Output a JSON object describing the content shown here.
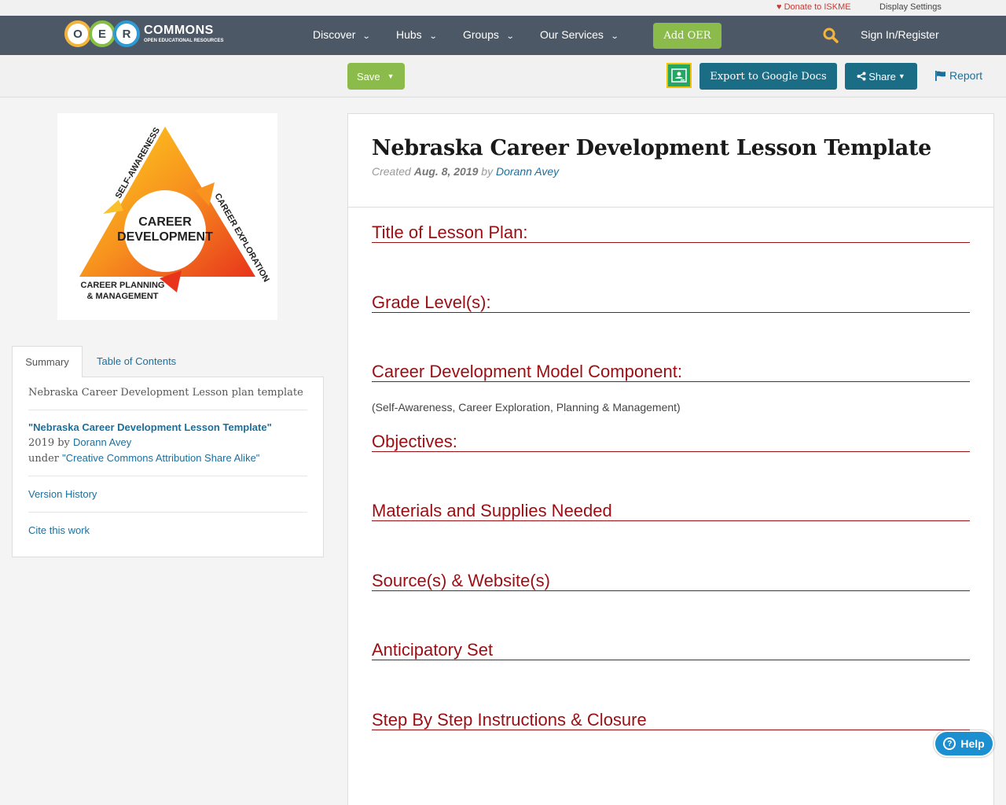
{
  "topbar": {
    "donate": "Donate to ISKME",
    "display_settings": "Display Settings"
  },
  "logo": {
    "letters": [
      "O",
      "E",
      "R"
    ],
    "name": "COMMONS",
    "tagline": "OPEN EDUCATIONAL RESOURCES"
  },
  "nav": {
    "items": [
      {
        "label": "Discover"
      },
      {
        "label": "Hubs"
      },
      {
        "label": "Groups"
      },
      {
        "label": "Our Services"
      }
    ],
    "add_oer": "Add OER",
    "sign_in": "Sign In/Register"
  },
  "toolbar": {
    "save": "Save",
    "export": "Export to Google Docs",
    "share": "Share",
    "report": "Report"
  },
  "cover": {
    "center": [
      "CAREER",
      "DEVELOPMENT"
    ],
    "side_left": "SELF-AWARENESS",
    "side_right": "CAREER EXPLORATION",
    "bottom": [
      "CAREER PLANNING",
      "& MANAGEMENT"
    ]
  },
  "sidebar": {
    "tabs": [
      "Summary",
      "Table of Contents"
    ],
    "description": "Nebraska Career Development Lesson plan template",
    "attribution": {
      "title": "\"Nebraska Career Development Lesson Template\"",
      "year_by": "2019 by",
      "author": "Dorann Avey",
      "under": "under",
      "license": "\"Creative Commons Attribution Share Alike\""
    },
    "version_history": "Version History",
    "cite": "Cite this work"
  },
  "document": {
    "title": "Nebraska Career Development Lesson Template",
    "created_label": "Created",
    "date": "Aug. 8, 2019",
    "by": "by",
    "author": "Dorann Avey",
    "sections": [
      {
        "heading": "Title of Lesson Plan:",
        "body": ""
      },
      {
        "heading": "Grade Level(s):",
        "body": ""
      },
      {
        "heading": "Career Development Model Component:",
        "body": "(Self-Awareness, Career Exploration, Planning & Management)"
      },
      {
        "heading": "Objectives:",
        "body": ""
      },
      {
        "heading": "Materials and Supplies Needed",
        "body": ""
      },
      {
        "heading": "Source(s) & Website(s)",
        "body": ""
      },
      {
        "heading": "Anticipatory Set",
        "body": ""
      },
      {
        "heading": "Step By Step Instructions & Closure",
        "body": ""
      }
    ]
  },
  "help": {
    "label": "Help"
  },
  "colors": {
    "nav_bg": "#4d5867",
    "green": "#8bbb4a",
    "teal": "#1b6d86",
    "heading_red": "#9b0e13",
    "link": "#1d6f9b"
  }
}
